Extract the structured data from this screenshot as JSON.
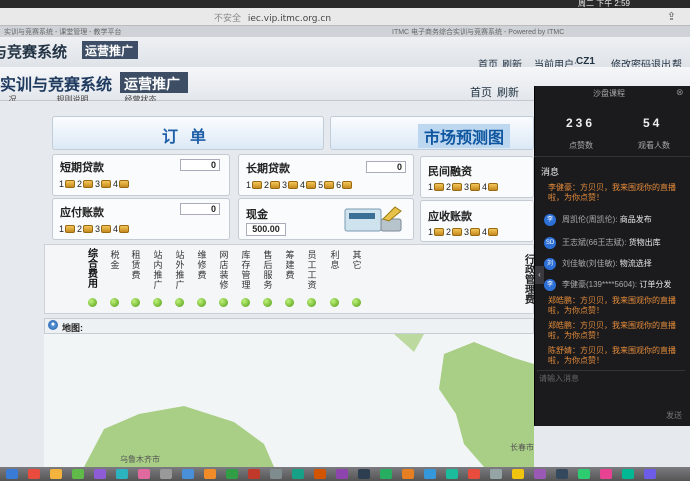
{
  "browser": {
    "clock": "周二 下午 2:59",
    "security": "不安全",
    "url": "iec.vip.itmc.org.cn",
    "tab_left": "实训与竞赛系统 - 课堂管理 - 教学平台",
    "tab_right": "ITMC 电子商务综合实训与竞赛系统 - Powered by ITMC",
    "share_icon": "share-icon"
  },
  "ghost": {
    "title": "与竞赛系统",
    "badge": "运营推广",
    "nav": [
      "首页",
      "刷新",
      "当前用户:",
      "CZ1",
      "修改密码",
      "退出",
      "帮助"
    ],
    "sub": [
      "..况..",
      "..规则说明",
      "..经营状态"
    ]
  },
  "header": {
    "title": "实训与竞赛系统",
    "badge": "运营推广",
    "nav_home": "首页",
    "nav_refresh": "刷新"
  },
  "banner": {
    "order": "订单",
    "market": "市场预测图"
  },
  "panels": {
    "short_loan": {
      "label": "短期贷款",
      "value": "0",
      "slots": [
        "1",
        "2",
        "3",
        "4"
      ]
    },
    "long_loan": {
      "label": "长期贷款",
      "value": "0",
      "slots": [
        "1",
        "2",
        "3",
        "4",
        "5",
        "6"
      ]
    },
    "private_loan": {
      "label": "民间融资",
      "slots": [
        "1",
        "2",
        "3",
        "4"
      ]
    },
    "payable": {
      "label": "应付账款",
      "value": "0",
      "slots": [
        "1",
        "2",
        "3",
        "4"
      ]
    },
    "cash": {
      "label": "现金",
      "value": "500.00"
    },
    "receivable": {
      "label": "应收账款",
      "slots": [
        "1",
        "2",
        "3",
        "4"
      ]
    }
  },
  "fees": {
    "heading": "综合费用",
    "columns": [
      "税金",
      "租赁费",
      "站内推广",
      "站外推广",
      "维修费",
      "网店装修",
      "库存管理",
      "售后服务",
      "筹建费",
      "员工工资",
      "利息",
      "其它"
    ],
    "admin_heading": "行政管理费"
  },
  "map": {
    "label": "地图:",
    "cities": [
      "乌鲁木齐市",
      "长春市"
    ]
  },
  "live": {
    "title": "沙盘课程",
    "likes": "236",
    "likes_label": "点赞数",
    "viewers": "54",
    "viewers_label": "观看人数",
    "messages_label": "消息",
    "messages": [
      {
        "type": "greet",
        "text": "李健豪：方贝贝，我来围观你的直播啦，为你点赞！"
      },
      {
        "type": "log",
        "avatar": "李",
        "who": "周凯伦(周凯伦):",
        "act": "商品发布"
      },
      {
        "type": "log",
        "avatar": "SD",
        "who": "王志斌(66王志斌):",
        "act": "货物出库"
      },
      {
        "type": "log",
        "avatar": "刘",
        "who": "刘佳敏(刘佳敏):",
        "act": "物流选择"
      },
      {
        "type": "log",
        "avatar": "李",
        "who": "李健豪(139****5604):",
        "act": "订单分发"
      },
      {
        "type": "greet",
        "text": "郑皓鹏：方贝贝，我来围观你的直播啦，为你点赞！"
      },
      {
        "type": "greet",
        "text": "郑皓鹏：方贝贝，我来围观你的直播啦，为你点赞！"
      },
      {
        "type": "greet",
        "text": "陈舒婧：方贝贝，我来围观你的直播啦，为你点赞！"
      }
    ],
    "input_placeholder": "请输入消息",
    "send": "发送",
    "close": "⊗"
  },
  "colors": {
    "accent": "#1f5fa8",
    "greet": "#e58c3a",
    "drawer": "#1b1b1e",
    "indicator": "#4f9a12"
  }
}
